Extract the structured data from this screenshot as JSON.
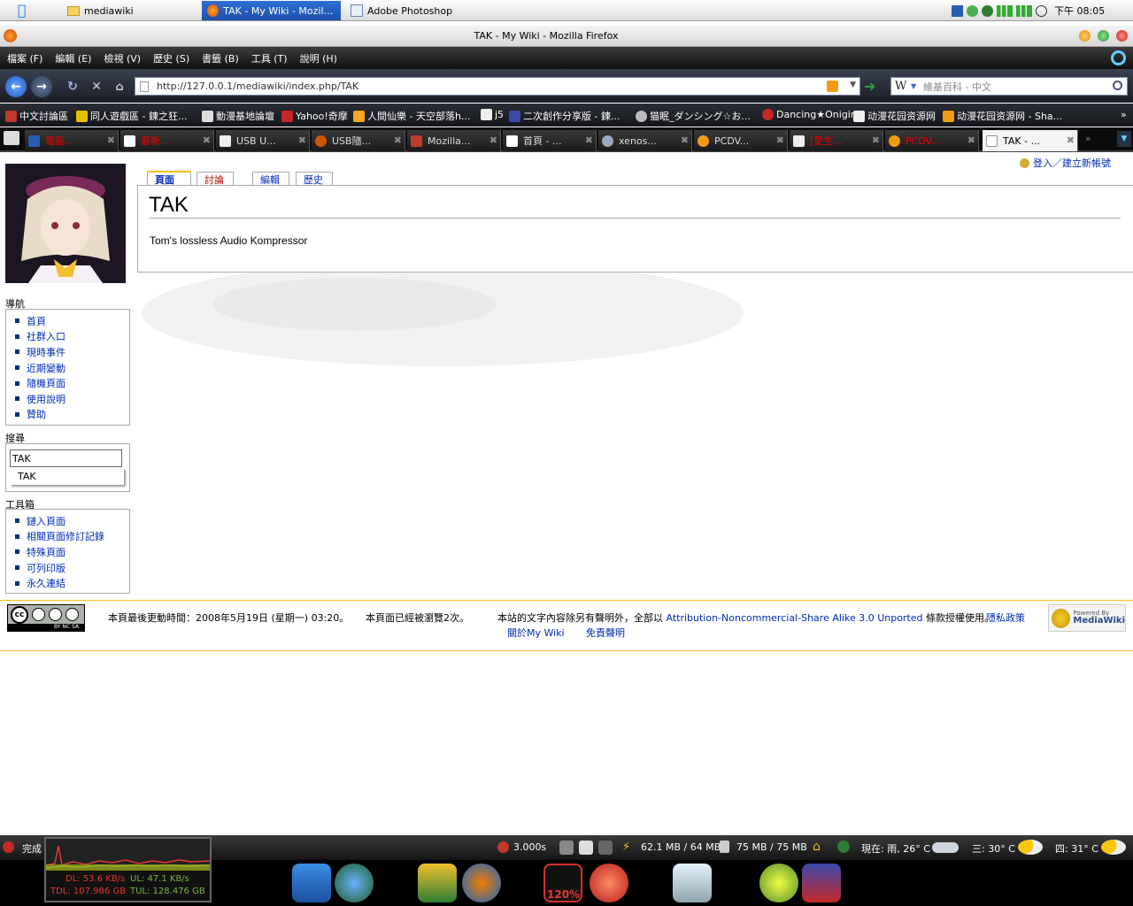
{
  "system_bar": {
    "tabs": [
      "mediawiki",
      "TAK - My Wiki - Mozilla...",
      "Adobe Photoshop"
    ],
    "clock": "下午 08:05"
  },
  "window": {
    "title": "TAK - My Wiki - Mozilla Firefox"
  },
  "menu": [
    "檔案 (F)",
    "編輯 (E)",
    "檢視 (V)",
    "歷史 (S)",
    "書籤 (B)",
    "工具 (T)",
    "說明 (H)"
  ],
  "navbar": {
    "url": "http://127.0.0.1/mediawiki/index.php/TAK",
    "search_placeholder": "維基百科 - 中文"
  },
  "bookmarks": [
    "中文討論區",
    "同人遊戲區 - 鍊之狂...",
    "動漫基地論壇",
    "Yahoo!奇摩",
    "人間仙樂 - 天空部落h...",
    "j5",
    "二次創作分享版 - 鍊...",
    "猫眠_ダンシング☆お...",
    "Dancing★Onigiri",
    "动漫花园资源网",
    "动漫花园资源网 - Sha..."
  ],
  "tabs": [
    {
      "label": "電腦...",
      "color": "red"
    },
    {
      "label": "最新...",
      "color": "red"
    },
    {
      "label": "USB U...",
      "color": "normal"
    },
    {
      "label": "USB隨...",
      "color": "normal"
    },
    {
      "label": "Mozilla...",
      "color": "normal"
    },
    {
      "label": "首頁 - ...",
      "color": "normal"
    },
    {
      "label": "xenos...",
      "color": "normal"
    },
    {
      "label": "PCDV...",
      "color": "normal"
    },
    {
      "label": "[愛生...",
      "color": "red"
    },
    {
      "label": "PCDV...",
      "color": "red"
    },
    {
      "label": "TAK - ...",
      "color": "active"
    }
  ],
  "wiki": {
    "login_link": "登入／建立新帳號",
    "page_tabs": [
      "頁面",
      "討論",
      "編輯",
      "歷史"
    ],
    "page_title": "TAK",
    "body_text": "Tom's lossless Audio Kompressor",
    "nav_title": "導航",
    "nav_items": [
      "首頁",
      "社群入口",
      "現時事件",
      "近期變動",
      "隨機頁面",
      "使用說明",
      "贊助"
    ],
    "search_title": "搜尋",
    "search_value": "TAK",
    "search_suggestion": "TAK",
    "toolbox_title": "工具箱",
    "toolbox_items": [
      "鏈入頁面",
      "相關頁面修訂記錄",
      "特殊頁面",
      "可列印版",
      "永久連結"
    ],
    "footer": {
      "last_modified": "本頁最後更動時間：2008年5月19日 (星期一) 03:20。",
      "views": "本頁面已經被瀏覽2次。",
      "license_prefix": "本站的文字內容除另有聲明外，全部以",
      "license_link": "Attribution-Noncommercial-Share Alike 3.0 Unported",
      "license_suffix": "條款授權使用。",
      "privacy": "隱私政策",
      "about": "關於My Wiki",
      "disclaimer": "免責聲明",
      "powered_by": "Powered By",
      "mediawiki": "MediaWiki",
      "cc_text": "cc",
      "cc_terms": "BY  NC  SA"
    }
  },
  "status_bar": {
    "status": "完成",
    "timer": "3.000s",
    "memory1": "62.1 MB / 64 MB",
    "memory2": "75 MB / 75 MB",
    "weather_now": "現在: 雨, 26° C",
    "weather_wed": "三: 30° C",
    "weather_thu": "四: 31° C",
    "dl": "DL: 53.6 KB/s",
    "ul": "UL: 47.1 KB/s",
    "tdl": "TDL: 107.986 GB",
    "tul": "TUL: 128.476 GB",
    "zoom": "120%"
  }
}
